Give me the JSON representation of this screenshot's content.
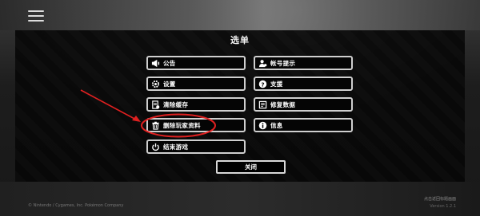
{
  "modal": {
    "title": "选单",
    "close_label": "关闭"
  },
  "menu": {
    "announcement": "公告",
    "account_check": "帐号提示",
    "settings": "设置",
    "support": "支援",
    "clear_cache": "清除缓存",
    "repair_data": "修复数据",
    "delete_player_data": "删除玩家资料",
    "info": "信息",
    "quit_game": "结束游戏"
  },
  "footer": {
    "copyright": "© Nintendo / Cygames, Inc. Pokémon Company",
    "right_line1": "点击返回标题画面",
    "right_line2": "Version 1.2.1"
  },
  "annotation": {
    "color": "#e02020"
  },
  "icons": [
    "megaphone-icon",
    "user-icon",
    "gear-icon",
    "question-icon",
    "cache-icon",
    "repair-icon",
    "trash-icon",
    "info-icon",
    "power-icon",
    "hamburger-menu-icon"
  ]
}
